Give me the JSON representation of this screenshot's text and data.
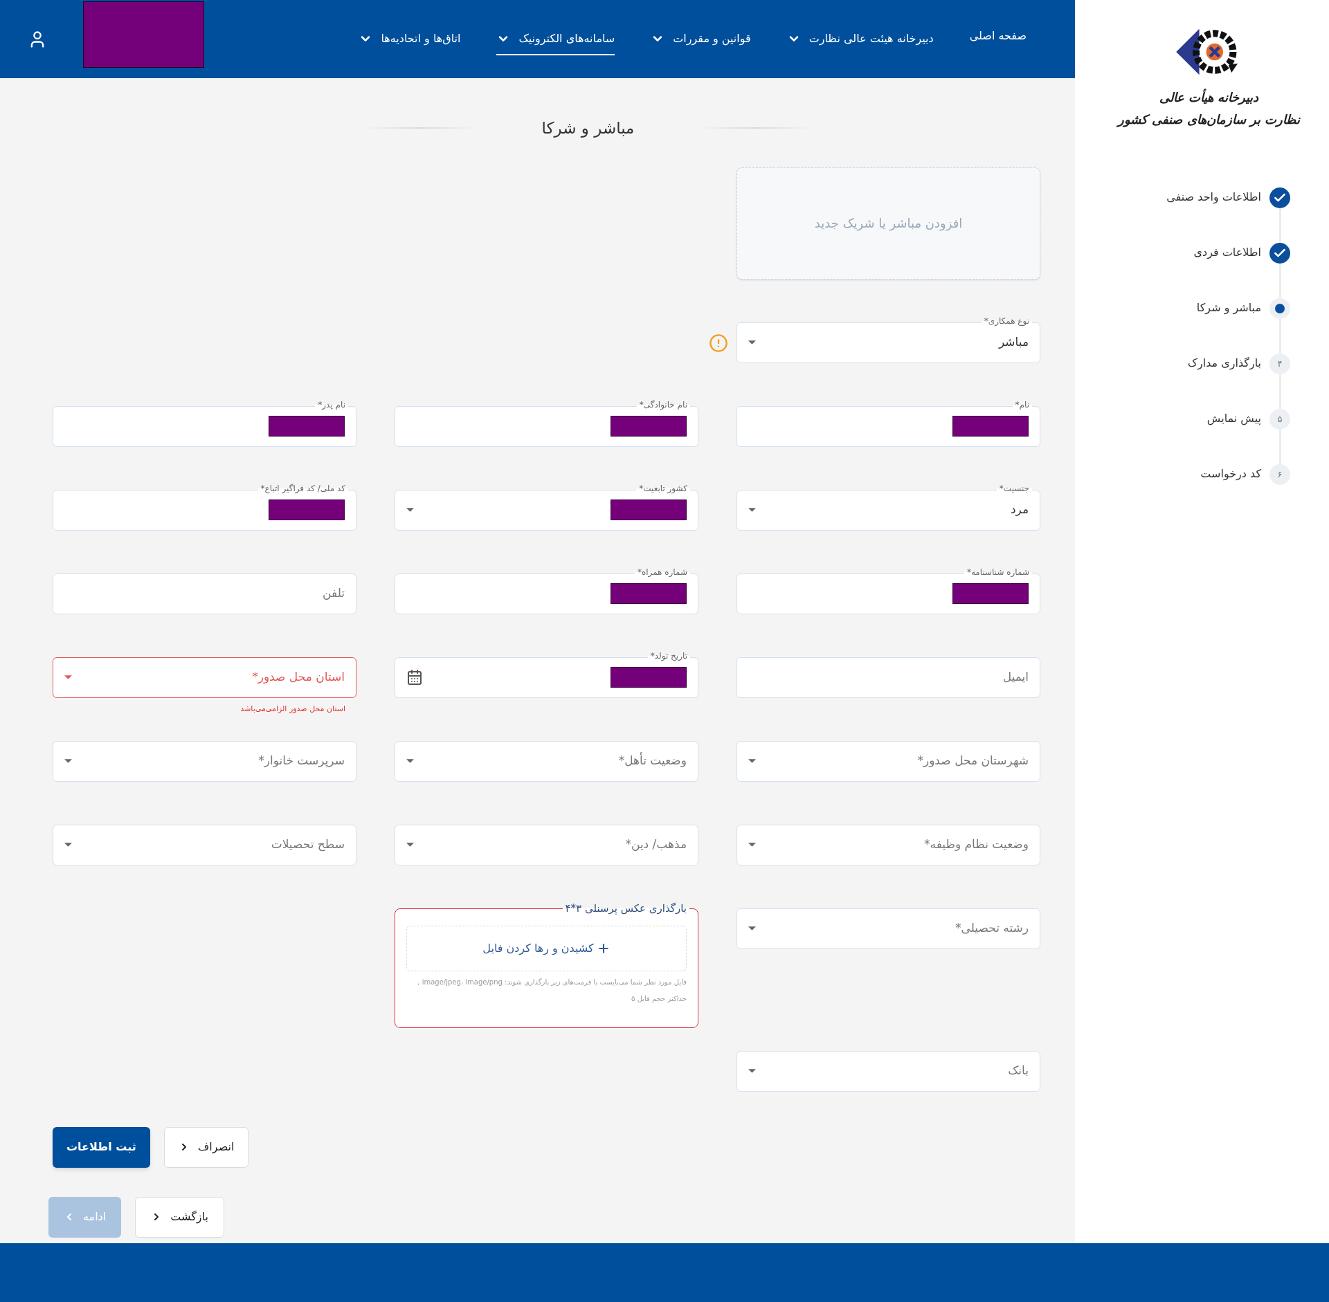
{
  "nav": {
    "items": [
      {
        "label": "صفحه اصلی",
        "selected": false,
        "has_menu": false
      },
      {
        "label": "دبیرخانه هیئت عالی نظارت",
        "selected": false,
        "has_menu": true
      },
      {
        "label": "قوانین و مقررات",
        "selected": false,
        "has_menu": true
      },
      {
        "label": "سامانه‌های الکترونیک",
        "selected": true,
        "has_menu": true
      },
      {
        "label": "اتاق‌ها و اتحادیه‌ها",
        "selected": false,
        "has_menu": true
      }
    ],
    "user": {
      "redacted": true
    }
  },
  "sidebar": {
    "logo_lines": [
      "دبیرخانه هیأت عالی",
      "نظارت بر سازمان‌های صنفی کشور"
    ],
    "steps": [
      {
        "label": "اطلاعات واحد صنفی",
        "kind": "done"
      },
      {
        "label": "اطلاعات فردی",
        "kind": "done"
      },
      {
        "label": "مباشر و شرکا",
        "kind": "current"
      },
      {
        "label": "بارگذاری مدارک",
        "kind": "pending",
        "number": "۴"
      },
      {
        "label": "پیش نمایش",
        "kind": "pending",
        "number": "۵"
      },
      {
        "label": "کد درخواست",
        "kind": "pending",
        "number": "۶"
      }
    ]
  },
  "page_title": "مباشر و شرکا",
  "rows": [
    [
      {
        "kind": "add-card",
        "text": "افزودن مباشر یا شریک جدید"
      }
    ],
    [
      {
        "kind": "select",
        "label": "نوع همکاری*",
        "value": "مباشر",
        "warning": true
      }
    ],
    [
      {
        "kind": "text",
        "label": "نام*",
        "redacted": true
      },
      {
        "kind": "text",
        "label": "نام خانوادگی*",
        "redacted": true
      },
      {
        "kind": "text",
        "label": "نام پدر*",
        "redacted": true
      }
    ],
    [
      {
        "kind": "select",
        "label": "جنسیت*",
        "value": "مرد"
      },
      {
        "kind": "select",
        "label": "کشور تابعیت*",
        "redacted": true
      },
      {
        "kind": "text",
        "label": "کد ملی/ کد فراگیر اتباع*",
        "redacted": true
      }
    ],
    [
      {
        "kind": "text",
        "label": "شماره شناسنامه*",
        "redacted": true
      },
      {
        "kind": "text",
        "label": "شماره همراه*",
        "redacted": true
      },
      {
        "kind": "text",
        "placeholder": "تلفن"
      }
    ],
    [
      {
        "kind": "text",
        "placeholder": "ایمیل"
      },
      {
        "kind": "date",
        "label": "تاریخ تولد*",
        "redacted": true
      },
      {
        "kind": "select",
        "placeholder": "استان محل صدور*",
        "error": true,
        "error_text": "استان محل صدور الزامی‌می‌باشد"
      }
    ],
    [
      {
        "kind": "select",
        "placeholder": "شهرستان محل صدور*"
      },
      {
        "kind": "select",
        "placeholder": "وضعیت تأهل*"
      },
      {
        "kind": "select",
        "placeholder": "سرپرست خانوار*"
      }
    ],
    [
      {
        "kind": "select",
        "placeholder": "وضعیت نظام وظیفه*"
      },
      {
        "kind": "select",
        "placeholder": "مذهب/ دین*"
      },
      {
        "kind": "select",
        "placeholder": "سطح تحصیلات"
      }
    ],
    [
      {
        "kind": "select",
        "placeholder": "رشته تحصیلی*"
      },
      {
        "kind": "upload",
        "label": "بارگذاری عکس پرسنلی ۳*۴",
        "drop_text": "کشیدن و رها کردن فایل",
        "hint": "فایل مورد نظر شما می‌بایست با فرمت‌های زیر بارگذاری شوند: image/jpeg، image/png ,",
        "max_size": "حداکثر حجم فایل ۵",
        "error": true
      }
    ],
    [
      {
        "kind": "select",
        "placeholder": "بانک"
      }
    ]
  ],
  "form_buttons": [
    {
      "label": "انصراف",
      "kind": "secondary"
    },
    {
      "label": "ثبت اطلاعات",
      "kind": "primary"
    }
  ],
  "nav_buttons": [
    {
      "label": "بازگشت",
      "kind": "back",
      "disabled": false
    },
    {
      "label": "ادامه",
      "kind": "next",
      "disabled": true
    }
  ]
}
